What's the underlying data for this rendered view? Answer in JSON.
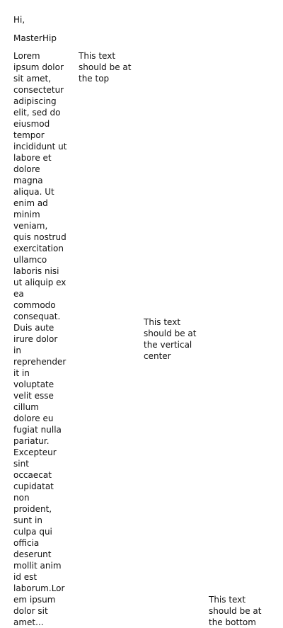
{
  "greeting": {
    "line1": "Hi,",
    "line2": "MasterHip"
  },
  "columns": {
    "lorem": "Lorem ipsum dolor sit amet, consectetur adipiscing elit, sed do eiusmod tempor incididunt ut labore et dolore magna aliqua. Ut enim ad minim veniam, quis nostrud exercitation ullamco laboris nisi ut aliquip ex ea commodo consequat. Duis aute irure dolor in reprehenderit in voluptate velit esse cillum dolore eu fugiat nulla pariatur. Excepteur sint occaecat cupidatat non proident, sunt in culpa qui officia deserunt mollit anim id est laborum.Lorem ipsum dolor sit amet...",
    "top": "This text should be at the top",
    "center": "This text should be at the vertical center",
    "bottom": "This text should be at the bottom"
  }
}
